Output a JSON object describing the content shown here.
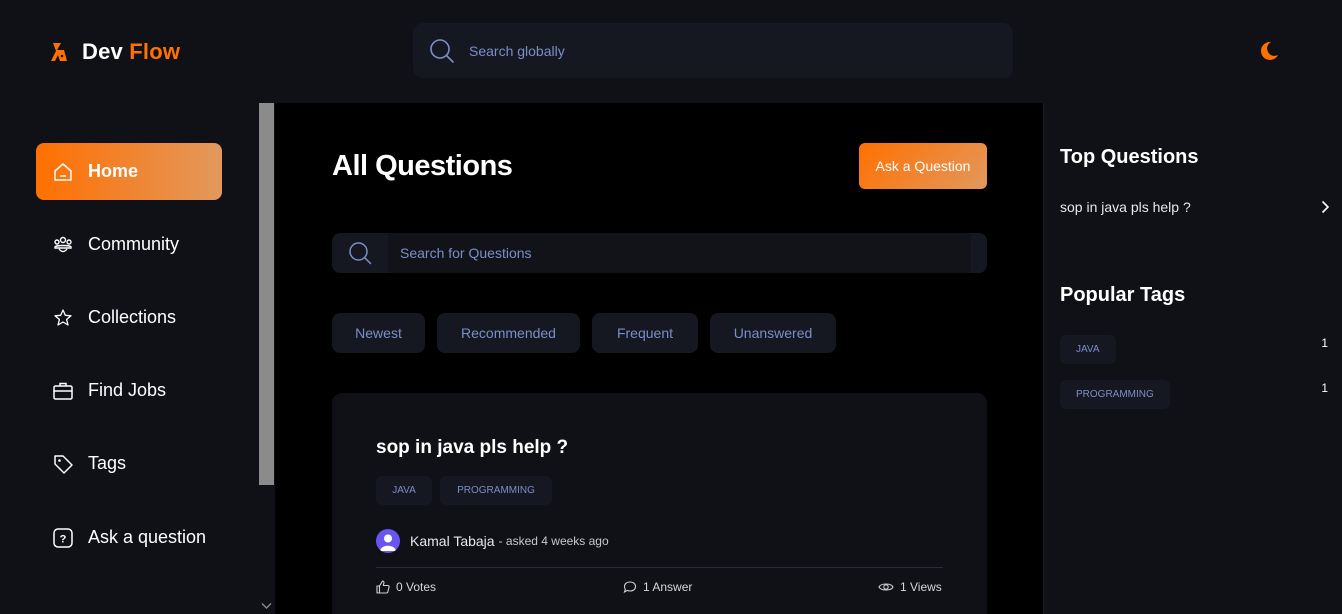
{
  "brand": {
    "part1": "Dev",
    "part2": "Flow",
    "accent": "#ff7000"
  },
  "header": {
    "search_placeholder": "Search globally",
    "theme_icon": "moon-icon"
  },
  "sidebar": {
    "items": [
      {
        "label": "Home",
        "icon": "home-icon",
        "active": true
      },
      {
        "label": "Community",
        "icon": "users-icon",
        "active": false
      },
      {
        "label": "Collections",
        "icon": "star-icon",
        "active": false
      },
      {
        "label": "Find Jobs",
        "icon": "briefcase-icon",
        "active": false
      },
      {
        "label": "Tags",
        "icon": "tag-icon",
        "active": false
      },
      {
        "label": "Ask a question",
        "icon": "question-icon",
        "active": false
      }
    ]
  },
  "main": {
    "title": "All Questions",
    "ask_button": "Ask a Question",
    "search_placeholder": "Search for Questions",
    "filters": [
      "Newest",
      "Recommended",
      "Frequent",
      "Unanswered"
    ],
    "questions": [
      {
        "title": "sop in java pls help ?",
        "tags": [
          "java",
          "programming"
        ],
        "author": "Kamal Tabaja",
        "asked": "- asked 4 weeks ago",
        "votes": "0 Votes",
        "answers": "1 Answer",
        "views": "1 Views"
      }
    ]
  },
  "rightbar": {
    "top_questions_heading": "Top Questions",
    "top_questions": [
      "sop in java pls help ?"
    ],
    "popular_tags_heading": "Popular Tags",
    "popular_tags": [
      {
        "name": "java",
        "count": "1"
      },
      {
        "name": "programming",
        "count": "1"
      }
    ]
  }
}
